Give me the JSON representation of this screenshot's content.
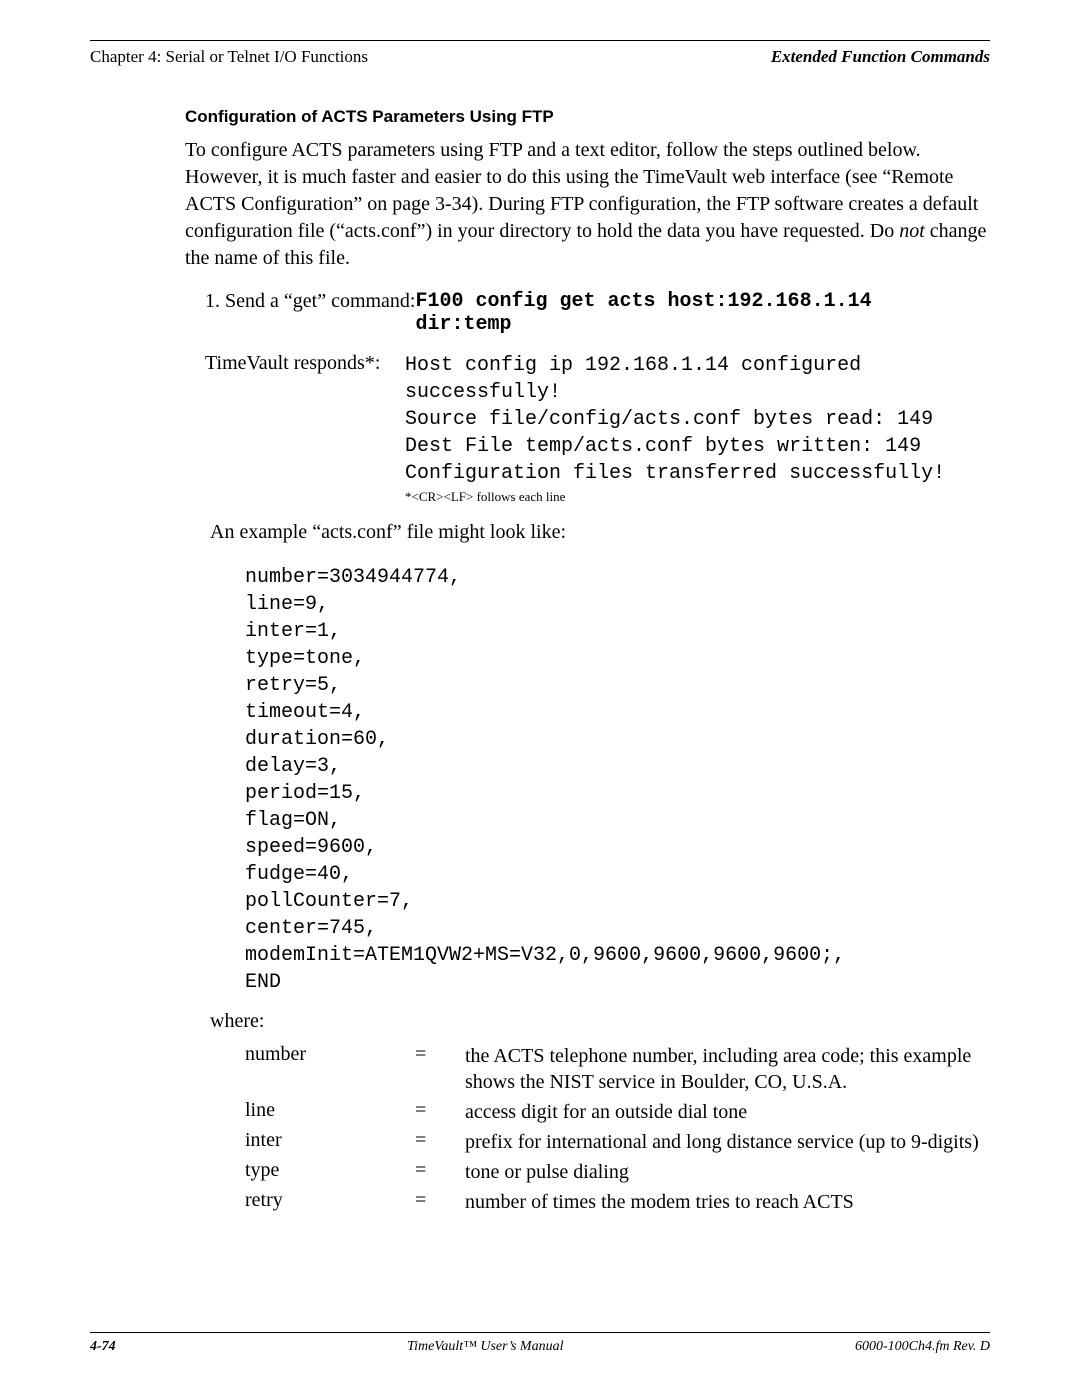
{
  "header": {
    "left": "Chapter 4: Serial or Telnet I/O Functions",
    "right": "Extended Function Commands"
  },
  "section_heading": "Configuration of ACTS Parameters Using FTP",
  "intro_paragraph_pre": "To configure ACTS parameters using FTP and a text editor, follow the steps outlined below.  However, it is much faster and easier to do this using the TimeVault web interface (see “Remote ACTS Configuration” on page 3-34).  During FTP configuration, the FTP software creates a default configuration file (“acts.conf”) in your directory to hold the data you have requested.  Do ",
  "intro_not": "not",
  "intro_paragraph_post": " change the name of this file.",
  "step1_label": "1. Send a “get” command: ",
  "step1_code": "F100 config get acts host:192.168.1.14\ndir:temp",
  "resp_label": "TimeVault responds*:",
  "resp_block": "Host config ip 192.168.1.14 configured\nsuccessfully!\nSource file/config/acts.conf bytes read: 149\nDest File temp/acts.conf bytes written: 149\nConfiguration files transferred successfully!",
  "resp_note": "*<CR><LF>  follows each line",
  "example_intro": "An example “acts.conf” file might look like:",
  "conf_block": "number=3034944774,\nline=9,\ninter=1,\ntype=tone,\nretry=5,\ntimeout=4,\nduration=60,\ndelay=3,\nperiod=15,\nflag=ON,\nspeed=9600,\nfudge=40,\npollCounter=7,\ncenter=745,\nmodemInit=ATEM1QVW2+MS=V32,0,9600,9600,9600,9600;,\nEND",
  "where_label": "where:",
  "defs": [
    {
      "term": "number",
      "desc": "the ACTS telephone number, including area code; this example shows the NIST service in Boulder, CO, U.S.A."
    },
    {
      "term": "line",
      "desc": "access digit for an outside dial tone"
    },
    {
      "term": "inter",
      "desc": "prefix for international and long distance service (up to 9-digits)"
    },
    {
      "term": "type",
      "desc": "tone or pulse dialing"
    },
    {
      "term": "retry",
      "desc": "number of times the modem tries to reach ACTS"
    }
  ],
  "footer": {
    "left": "4-74",
    "center": "TimeVault™ User’s Manual",
    "right": "6000-100Ch4.fm  Rev. D"
  }
}
